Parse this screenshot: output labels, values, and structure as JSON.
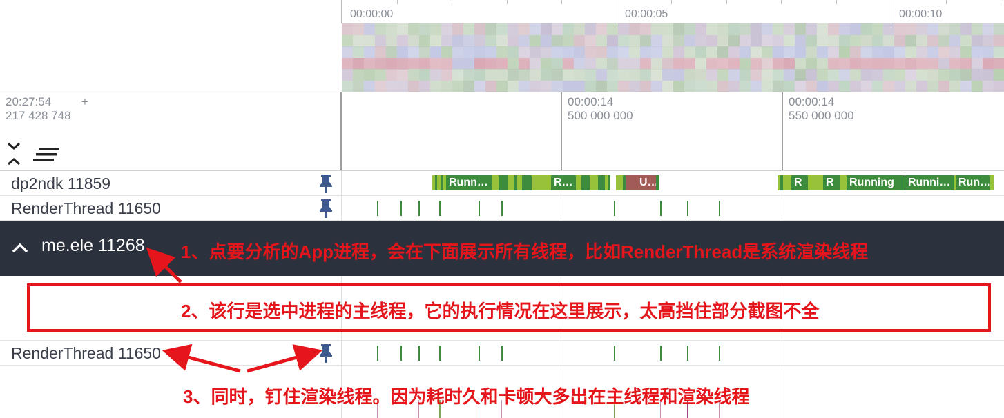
{
  "overview": {
    "time_labels": [
      "00:00:00",
      "00:00:05",
      "00:00:10"
    ]
  },
  "ruler": {
    "base_time": "20:27:54",
    "base_ns": "217 428 748",
    "plus": "+",
    "marks": [
      {
        "time": "00:00:14",
        "ns": "500 000 000"
      },
      {
        "time": "00:00:14",
        "ns": "550 000 000"
      }
    ]
  },
  "tracks": {
    "pinned_main": {
      "label": "dp2ndk 11859"
    },
    "pinned_render": {
      "label": "RenderThread 11650"
    },
    "process": {
      "label": "me.ele 11268"
    },
    "render_thread": {
      "label": "RenderThread 11650"
    }
  },
  "slices": [
    "Runn…",
    "R…",
    "U…",
    "R",
    "R",
    "Running",
    "Runni…",
    "Run…"
  ],
  "annotations": {
    "note1": "1、点要分析的App进程，会在下面展示所有线程，比如RenderThread是系统渲染线程",
    "note2": "2、该行是选中进程的主线程，它的执行情况在这里展示，太高挡住部分截图不全",
    "note3": "3、同时，钉住渲染线程。因为耗时久和卡顿大多出在主线程和渲染线程"
  },
  "colors": {
    "running": "#3d8b3d",
    "runnable": "#98c23a",
    "uninterruptible": "#a25c58",
    "process_header": "#2b313d",
    "annotation": "#e5161b",
    "pin": "#3e5a8f"
  },
  "icons": [
    "pin-icon",
    "chevron-up-icon",
    "collapse-icon",
    "filter-icon"
  ]
}
